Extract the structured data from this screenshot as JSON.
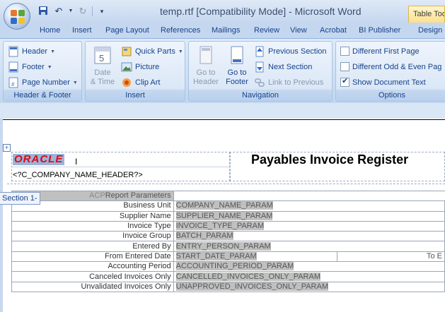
{
  "window": {
    "title": "temp.rtf [Compatibility Mode] - Microsoft Word",
    "contextual_tab": "Table Tools"
  },
  "tabs": [
    "Home",
    "Insert",
    "Page Layout",
    "References",
    "Mailings",
    "Review",
    "View",
    "Acrobat",
    "BI Publisher",
    "Design"
  ],
  "ribbon": {
    "header_footer": {
      "label": "Header & Footer",
      "header": "Header",
      "footer": "Footer",
      "page_number": "Page Number"
    },
    "insert": {
      "label": "Insert",
      "date_time_1": "Date",
      "date_time_2": "& Time",
      "quick_parts": "Quick Parts",
      "picture": "Picture",
      "clip_art": "Clip Art"
    },
    "navigation": {
      "label": "Navigation",
      "goto_header_1": "Go to",
      "goto_header_2": "Header",
      "goto_footer_1": "Go to",
      "goto_footer_2": "Footer",
      "previous_section": "Previous Section",
      "next_section": "Next Section",
      "link_to_previous": "Link to Previous"
    },
    "options": {
      "label": "Options",
      "different_first_page": "Different First Page",
      "different_odd_even": "Different Odd & Even Pag",
      "show_document_text": "Show Document Text",
      "different_first_page_checked": false,
      "different_odd_even_checked": false,
      "show_document_text_checked": true
    }
  },
  "document": {
    "logo_text": "ORACLE",
    "report_title": "Payables Invoice Register",
    "company_tag": "<?C_COMPANY_NAME_HEADER?>",
    "section_label": "Section 1-",
    "params_header_prefix": "ACP",
    "params_header": "Report Parameters",
    "params": [
      {
        "label": "Business Unit",
        "value": "COMPANY_NAME_PARAM"
      },
      {
        "label": "Supplier Name",
        "value": "SUPPLIER_NAME_PARAM"
      },
      {
        "label": "Invoice Type",
        "value": "INVOICE_TYPE_PARAM"
      },
      {
        "label": "Invoice Group",
        "value": "BATCH_PARAM"
      },
      {
        "label": "Entered By",
        "value": "ENTRY_PERSON_PARAM"
      },
      {
        "label": "From Entered Date",
        "value": "START_DATE_PARAM",
        "extra": "To E"
      },
      {
        "label": "Accounting Period",
        "value": "ACCOUNTING_PERIOD_PARAM"
      },
      {
        "label": "Canceled Invoices Only",
        "value": "CANCELLED_INVOICES_ONLY_PARAM"
      },
      {
        "label": "Unvalidated Invoices Only",
        "value": "UNAPPROVED_INVOICES_ONLY_PARAM"
      }
    ]
  }
}
